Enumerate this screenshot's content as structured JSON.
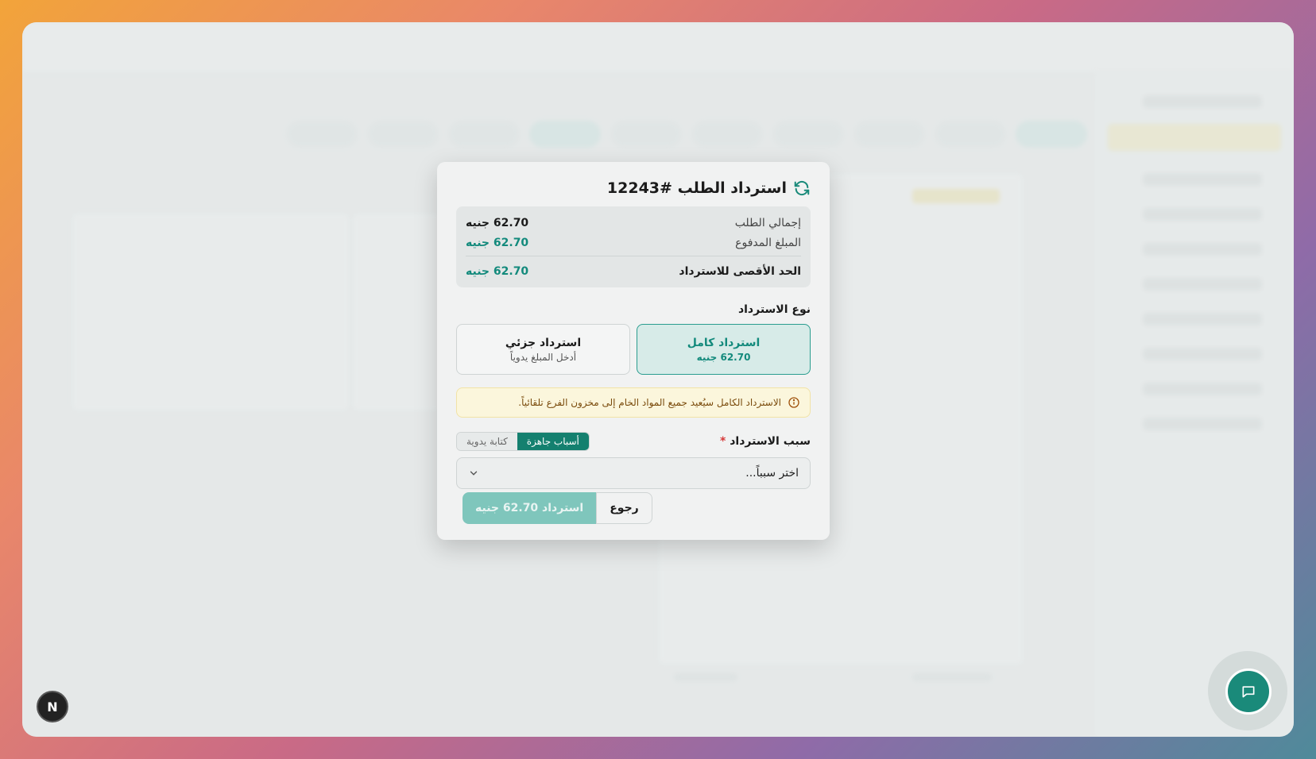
{
  "modal": {
    "title": "استرداد الطلب #12243",
    "summary": {
      "total_label": "إجمالي الطلب",
      "total_value": "62.70 جنيه",
      "paid_label": "المبلغ المدفوع",
      "paid_value": "62.70 جنيه",
      "max_label": "الحد الأقصى للاسترداد",
      "max_value": "62.70 جنيه"
    },
    "refund_type_label": "نوع الاسترداد",
    "full_refund": {
      "title": "استرداد كامل",
      "amount": "62.70 جنيه",
      "selected": true
    },
    "partial_refund": {
      "title": "استرداد جزئي",
      "hint": "أدخل المبلغ يدوياً",
      "selected": false
    },
    "notice": "الاسترداد الكامل سيُعيد جميع المواد الخام إلى مخزون الفرع تلقائياً.",
    "reason": {
      "label": "سبب الاسترداد",
      "required_mark": "*",
      "mode_preset": "أسباب جاهزة",
      "mode_manual": "كتابة يدوية",
      "active_mode": "preset",
      "select_placeholder": "اختر سبباً..."
    },
    "buttons": {
      "refund": "استرداد 62.70 جنيه",
      "back": "رجوع"
    }
  },
  "icons": {
    "refresh": "refresh-icon",
    "info": "info-icon",
    "chevron": "chevron-down-icon",
    "chat": "chat-icon"
  },
  "floating": {
    "next_badge": "N"
  },
  "colors": {
    "accent": "#138a7c",
    "refund_button": "#7fc6bc",
    "notice_bg": "#fbf6dc",
    "required": "#d63a3a"
  }
}
